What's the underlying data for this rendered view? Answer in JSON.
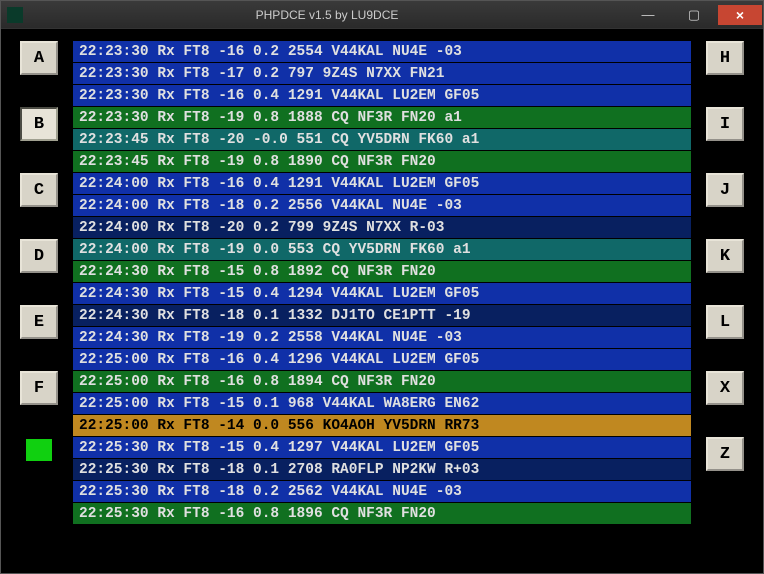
{
  "window": {
    "title": "PHPDCE v1.5 by LU9DCE"
  },
  "titlebar_buttons": {
    "minimize": "—",
    "maximize": "▢",
    "close": "×"
  },
  "left_buttons": [
    {
      "label": "A",
      "selected": false
    },
    {
      "label": "B",
      "selected": true
    },
    {
      "label": "C",
      "selected": false
    },
    {
      "label": "D",
      "selected": false
    },
    {
      "label": "E",
      "selected": false
    },
    {
      "label": "F",
      "selected": false
    }
  ],
  "right_buttons": [
    {
      "label": "H"
    },
    {
      "label": "I"
    },
    {
      "label": "J"
    },
    {
      "label": "K"
    },
    {
      "label": "L"
    },
    {
      "label": "X"
    },
    {
      "label": "Z"
    }
  ],
  "status_indicator_color": "#10d010",
  "log": [
    {
      "color": "blue",
      "text": "22:23:30 Rx FT8 -16 0.2 2554 V44KAL NU4E -03"
    },
    {
      "color": "blue",
      "text": "22:23:30 Rx FT8 -17 0.2 797 9Z4S N7XX FN21"
    },
    {
      "color": "blue",
      "text": "22:23:30 Rx FT8 -16 0.4 1291 V44KAL LU2EM GF05"
    },
    {
      "color": "green",
      "text": "22:23:30 Rx FT8 -19 0.8 1888 CQ NF3R FN20 a1"
    },
    {
      "color": "teal",
      "text": "22:23:45 Rx FT8 -20 -0.0 551 CQ YV5DRN FK60 a1"
    },
    {
      "color": "green",
      "text": "22:23:45 Rx FT8 -19 0.8 1890 CQ NF3R FN20"
    },
    {
      "color": "blue",
      "text": "22:24:00 Rx FT8 -16 0.4 1291 V44KAL LU2EM GF05"
    },
    {
      "color": "blue",
      "text": "22:24:00 Rx FT8 -18 0.2 2556 V44KAL NU4E -03"
    },
    {
      "color": "navy",
      "text": "22:24:00 Rx FT8 -20 0.2 799 9Z4S N7XX R-03"
    },
    {
      "color": "teal",
      "text": "22:24:00 Rx FT8 -19 0.0 553 CQ YV5DRN FK60 a1"
    },
    {
      "color": "green",
      "text": "22:24:30 Rx FT8 -15 0.8 1892 CQ NF3R FN20"
    },
    {
      "color": "blue",
      "text": "22:24:30 Rx FT8 -15 0.4 1294 V44KAL LU2EM GF05"
    },
    {
      "color": "navy",
      "text": "22:24:30 Rx FT8 -18 0.1 1332 DJ1TO CE1PTT -19"
    },
    {
      "color": "blue",
      "text": "22:24:30 Rx FT8 -19 0.2 2558 V44KAL NU4E -03"
    },
    {
      "color": "blue",
      "text": "22:25:00 Rx FT8 -16 0.4 1296 V44KAL LU2EM GF05"
    },
    {
      "color": "green",
      "text": "22:25:00 Rx FT8 -16 0.8 1894 CQ NF3R FN20"
    },
    {
      "color": "blue",
      "text": "22:25:00 Rx FT8 -15 0.1 968 V44KAL WA8ERG EN62"
    },
    {
      "color": "gold",
      "text": "22:25:00 Rx FT8 -14 0.0 556 KO4AOH YV5DRN RR73"
    },
    {
      "color": "blue",
      "text": "22:25:30 Rx FT8 -15 0.4 1297 V44KAL LU2EM GF05"
    },
    {
      "color": "navy",
      "text": "22:25:30 Rx FT8 -18 0.1 2708 RA0FLP NP2KW R+03"
    },
    {
      "color": "blue",
      "text": "22:25:30 Rx FT8 -18 0.2 2562 V44KAL NU4E -03"
    },
    {
      "color": "green",
      "text": "22:25:30 Rx FT8 -16 0.8 1896 CQ NF3R FN20"
    }
  ]
}
